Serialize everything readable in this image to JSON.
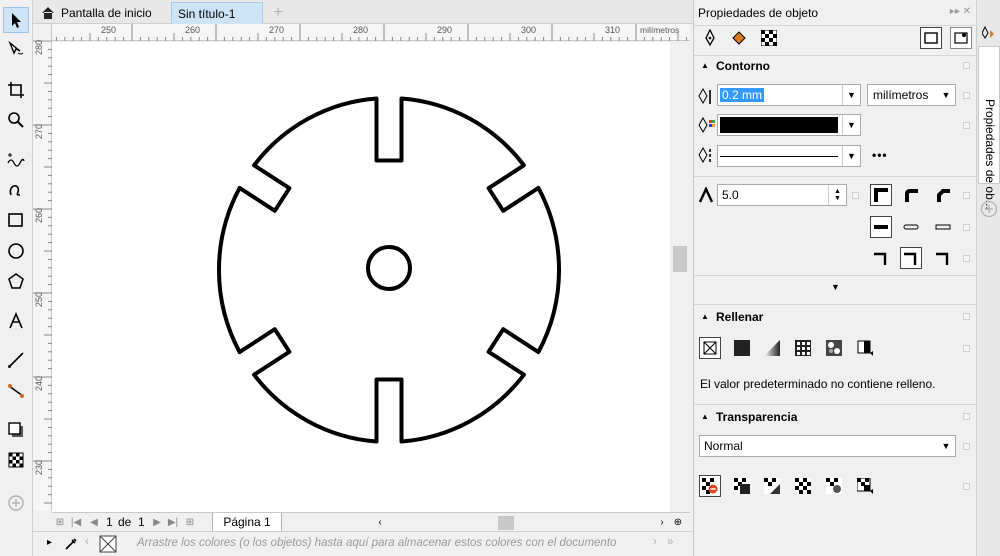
{
  "tabs": {
    "home": "Pantalla de inicio",
    "document": "Sin título-1",
    "add": "+"
  },
  "ruler": {
    "h_ticks": [
      "250",
      "260",
      "270",
      "280",
      "290",
      "300",
      "310"
    ],
    "h_unit": "milímetros",
    "v_ticks": [
      "280",
      "270",
      "260",
      "250",
      "240",
      "230"
    ]
  },
  "page_nav": {
    "current": "1",
    "separator": "de",
    "total": "1",
    "page_tab": "Página 1"
  },
  "statusbar": {
    "hint": "Arrastre los colores (o los objetos) hasta aquí para almacenar estos colores con el documento"
  },
  "docker": {
    "title": "Propiedades de objeto",
    "side_tab": "Propiedades de ob...",
    "outline": {
      "header": "Contorno",
      "width_value": "0.2 mm",
      "units": "milímetros",
      "miter_value": "5.0"
    },
    "fill": {
      "header": "Rellenar",
      "message": "El valor predeterminado no contiene relleno."
    },
    "transparency": {
      "header": "Transparencia",
      "mode": "Normal"
    }
  },
  "colors": {
    "accent": "#cde3f6",
    "selection": "#3399ff",
    "outline_color": "#000000"
  },
  "icons": {
    "toolbox": [
      "pointer-icon",
      "freehand-pick-icon",
      "crop-icon",
      "zoom-icon",
      "freehand-icon",
      "artistic-media-icon",
      "rectangle-icon",
      "ellipse-icon",
      "polygon-icon",
      "text-icon",
      "dimension-icon",
      "connector-icon",
      "drop-shadow-icon",
      "transparency-icon",
      "add-tool-icon"
    ]
  }
}
